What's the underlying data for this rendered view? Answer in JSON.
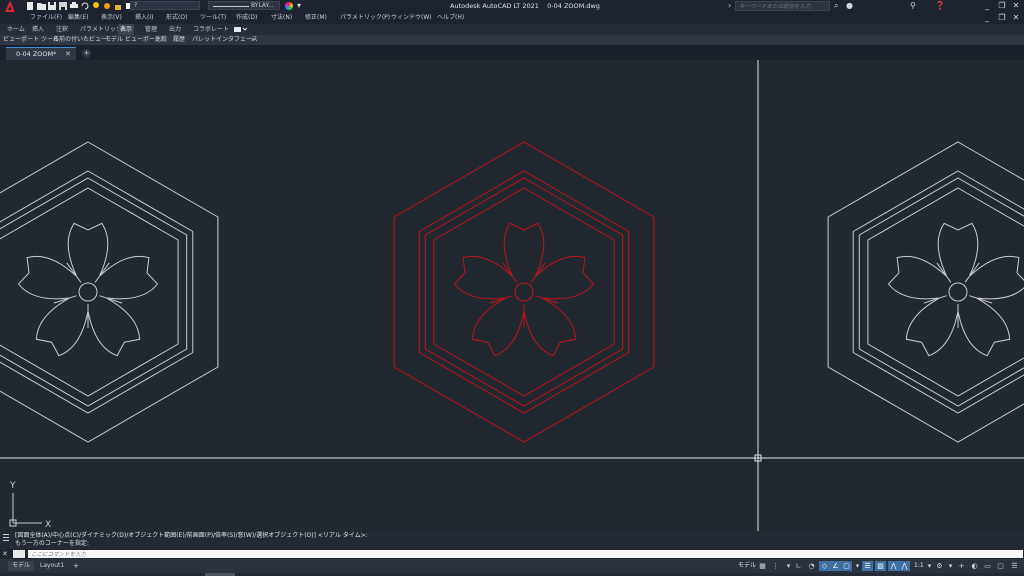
{
  "titlebar": {
    "app_title": "Autodesk AutoCAD LT 2021",
    "file_name": "0-04 ZOOM.dwg",
    "workspace_value": "?",
    "layer_value": "BYLAY...",
    "search_placeholder": "キーワードまたは語句を入力",
    "window_min": "_",
    "window_restore": "❐",
    "window_close": "✕"
  },
  "menubar": {
    "items": [
      "ファイル(F)",
      "編集(E)",
      "表示(V)",
      "挿入(I)",
      "形式(O)",
      "ツール(T)",
      "作成(D)",
      "寸法(N)",
      "修正(M)",
      "パラメトリック(P)",
      "ウィンドウ(W)",
      "ヘルプ(H)"
    ]
  },
  "ribbon": {
    "tabs": [
      "ホーム",
      "挿入",
      "注釈",
      "パラメトリック",
      "表示",
      "管理",
      "出力",
      "コラボレート"
    ],
    "active_tab": "表示",
    "panels": [
      "ビューポート ツール",
      "名前の付いたビュー",
      "モデル ビューポート",
      "比較",
      "履歴",
      "パレット",
      "インタフェース",
      "»"
    ]
  },
  "filetabs": {
    "active": "0-04 ZOOM*",
    "close": "✕",
    "new": "+"
  },
  "canvas": {
    "ucs_y_label": "Y",
    "ucs_x_label": "X",
    "drawing_colors": {
      "background": "#212830",
      "entity_white": "#c9ccd0",
      "entity_selected": "#c0151c"
    }
  },
  "command": {
    "history_line1": "[図面全体(A)/中心点(C)/ダイナミック(D)/オブジェクト範囲(E)/前画面(P)/倍率(S)/窓(W)/選択オブジェクト(O)] <リアル タイム>:",
    "history_line2": "もう一方のコーナーを指定:",
    "input_placeholder": "ここにコマンドを入力",
    "close_icon": "✕"
  },
  "statusbar": {
    "layout_tabs": [
      "モデル",
      "Layout1"
    ],
    "add_tab": "+",
    "model_label": "モデル",
    "scale": "1:1"
  }
}
